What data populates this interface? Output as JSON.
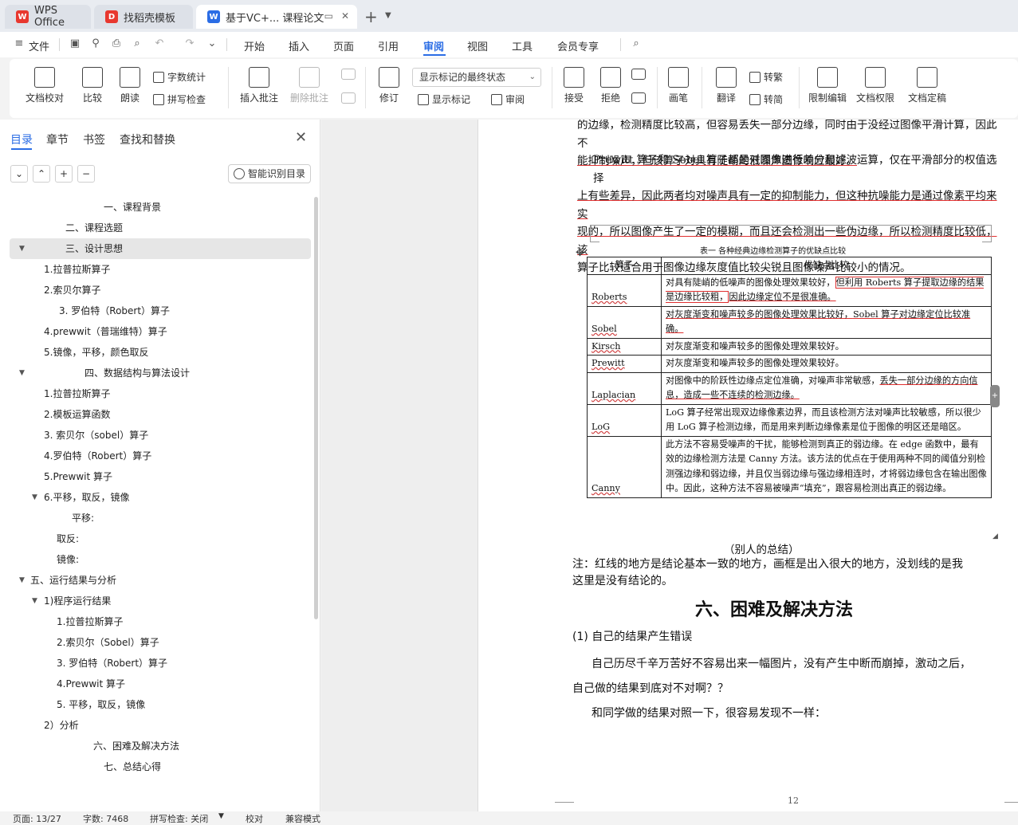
{
  "tabs": [
    {
      "label": "WPS Office",
      "icon": "wps-logo-icon",
      "color": "#e8382f"
    },
    {
      "label": "找稻壳模板",
      "icon": "docer-logo-icon",
      "color": "#e8382f"
    },
    {
      "label": "基于VC+... 课程论文",
      "icon": "word-doc-icon",
      "color": "#2b6de5"
    }
  ],
  "menu": {
    "file": "文件",
    "tabs": [
      "开始",
      "插入",
      "页面",
      "引用",
      "审阅",
      "视图",
      "工具",
      "会员专享"
    ],
    "active_tab": "审阅"
  },
  "ribbon": {
    "doc_check": "文档校对",
    "compare": "比较",
    "read_aloud": "朗读",
    "word_count": "字数统计",
    "spell_check": "拼写检查",
    "insert_comment": "插入批注",
    "delete_comment": "删除批注",
    "revise": "修订",
    "markup_state": "显示标记的最终状态",
    "show_markup": "显示标记",
    "review_pane": "审阅",
    "accept": "接受",
    "reject": "拒绝",
    "ink": "画笔",
    "translate": "翻译",
    "to_traditional": "转繁",
    "to_simplified": "转简",
    "restrict_edit": "限制编辑",
    "doc_permission": "文档权限",
    "doc_finalize": "文档定稿"
  },
  "nav": {
    "tabs": [
      "目录",
      "章节",
      "书签",
      "查找和替换"
    ],
    "smart_toc": "智能识别目录",
    "items": [
      {
        "text": "一、课程背景",
        "indent": 130,
        "toggle": ""
      },
      {
        "text": "二、课程选题",
        "indent": 82,
        "toggle": ""
      },
      {
        "text": "三、设计思想",
        "indent": 82,
        "toggle": "▼",
        "selected": true
      },
      {
        "text": "1.拉普拉斯算子",
        "indent": 55,
        "toggle": ""
      },
      {
        "text": "2.索贝尔算子",
        "indent": 55,
        "toggle": ""
      },
      {
        "text": "3. 罗伯特（Robert）算子",
        "indent": 74,
        "toggle": ""
      },
      {
        "text": "4.prewwit（普瑞维特）算子",
        "indent": 55,
        "toggle": ""
      },
      {
        "text": "5.镜像，平移，颜色取反",
        "indent": 55,
        "toggle": ""
      },
      {
        "text": "四、数据结构与算法设计",
        "indent": 106,
        "toggle": "▼"
      },
      {
        "text": "1.拉普拉斯算子",
        "indent": 55,
        "toggle": ""
      },
      {
        "text": "2.模板运算函数",
        "indent": 55,
        "toggle": ""
      },
      {
        "text": "3. 索贝尔（sobel）算子",
        "indent": 55,
        "toggle": ""
      },
      {
        "text": "4.罗伯特（Robert）算子",
        "indent": 55,
        "toggle": ""
      },
      {
        "text": "5.Prewwit 算子",
        "indent": 55,
        "toggle": ""
      },
      {
        "text": "6.平移，取反，镜像",
        "indent": 55,
        "toggle": "▼"
      },
      {
        "text": "平移:",
        "indent": 90,
        "toggle": ""
      },
      {
        "text": "取反:",
        "indent": 71,
        "toggle": ""
      },
      {
        "text": "镜像:",
        "indent": 71,
        "toggle": ""
      },
      {
        "text": "五、运行结果与分析",
        "indent": 38,
        "toggle": "▼"
      },
      {
        "text": "1)程序运行结果",
        "indent": 55,
        "toggle": "▼"
      },
      {
        "text": "1.拉普拉斯算子",
        "indent": 71,
        "toggle": ""
      },
      {
        "text": "2.索贝尔（Sobel）算子",
        "indent": 71,
        "toggle": ""
      },
      {
        "text": "3. 罗伯特（Robert）算子",
        "indent": 71,
        "toggle": ""
      },
      {
        "text": "4.Prewwit 算子",
        "indent": 71,
        "toggle": ""
      },
      {
        "text": "5. 平移，取反，镜像",
        "indent": 71,
        "toggle": ""
      },
      {
        "text": "2）分析",
        "indent": 55,
        "toggle": ""
      },
      {
        "text": "六、困难及解决方法",
        "indent": 117,
        "toggle": ""
      },
      {
        "text": "七、总结心得",
        "indent": 130,
        "toggle": ""
      }
    ]
  },
  "document": {
    "para1_line1": "的边缘，检测精度比较高，但容易丢失一部分边缘，同时由于没经过图像平滑计算，因此不",
    "para1_line2": "能抑制噪声，但该算子对具有陡峭的低噪声图像响应最好。",
    "para2_line1": "Prewitt 算子和 Sobel 算子都是对图像进行差分和滤波运算，仅在平滑部分的权值选择",
    "para2_line2": "上有些差异，因此两者均对噪声具有一定的抑制能力，但这种抗噪能力是通过像素平均来实",
    "para2_line3": "现的，所以图像产生了一定的模糊，而且还会检测出一些伪边缘，所以检测精度比较低，该",
    "para2_line4": "算子比较适合用于图像边缘灰度值比较尖锐且图像噪声比较小的情况。",
    "table_caption": "表一 各种经典边缘检测算子的优缺点比较",
    "table_headers": [
      "算子",
      "优缺点比较"
    ],
    "table_rows": [
      {
        "name": "Roberts",
        "desc_a": "对具有陡峭的低噪声的图像处理效果较好，",
        "desc_b": "但利用 Roberts 算子提取边缘的结果是边缘比较粗，",
        "desc_c": "因此边缘定位不是很准确。"
      },
      {
        "name": "Sobel",
        "desc_a": "对灰度渐变和噪声较多的图像处理效果比较好，",
        "desc_b": "Sobel 算子对边缘定位比较准确。",
        "desc_c": ""
      },
      {
        "name": "Kirsch",
        "desc_a": "对灰度渐变和噪声较多的图像处理效果较好。",
        "desc_b": "",
        "desc_c": ""
      },
      {
        "name": "Prewitt",
        "desc_a": "对灰度渐变和噪声较多的图像处理效果较好。",
        "desc_b": "",
        "desc_c": ""
      },
      {
        "name": "Laplacian",
        "desc_a": "对图像中的阶跃性边缘点定位准确，对噪声非常敏感，",
        "desc_b": "丢失一部分边缘的方向信息，造成一些不连续的检测边缘。",
        "desc_c": ""
      },
      {
        "name": "LoG",
        "desc_a": "LoG 算子经常出现双边缘像素边界，而且该检测方法对噪声比较敏感，所以很少用 LoG 算子检测边缘，而是用来判断边缘像素是位于图像的明区还是暗区。",
        "desc_b": "",
        "desc_c": ""
      },
      {
        "name": "Canny",
        "desc_a": "此方法不容易受噪声的干扰，能够检测到真正的弱边缘。在 edge 函数中，最有效的边缘检测方法是 Canny 方法。该方法的优点在于使用两种不同的阈值分别检测强边缘和弱边缘，并且仅当弱边缘与强边缘相连时，才将弱边缘包含在输出图像中。因此，这种方法不容易被噪声“填充”，跟容易检测出真正的弱边缘。",
        "desc_b": "",
        "desc_c": ""
      }
    ],
    "table_note": "（别人的总结）",
    "note_line1": "注：红线的地方是结论基本一致的地方，画框是出入很大的地方，没划线的是我",
    "note_line2": "这里是没有结论的。",
    "heading6": "六、困难及解决方法",
    "sub1": "(1)  自己的结果产生错误",
    "para3_line1": "自己历尽千辛万苦好不容易出来一幅图片，没有产生中断而崩掉，激动之后，",
    "para3_line2": "自己做的结果到底对不对啊？？",
    "para4": "和同学做的结果对照一下，很容易发现不一样：",
    "page_number": "12"
  },
  "status": {
    "page": "页面: 13/27",
    "words": "字数: 7468",
    "spell": "拼写检查: 关闭",
    "proof": "校对",
    "compat": "兼容模式"
  }
}
